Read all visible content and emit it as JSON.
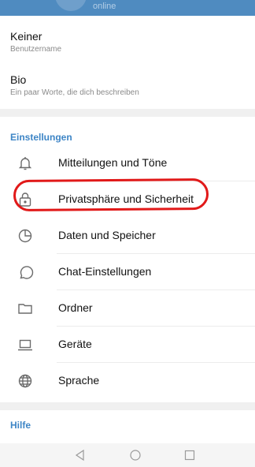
{
  "header": {
    "status": "online"
  },
  "profile": {
    "username_value": "Keiner",
    "username_caption": "Benutzername",
    "bio_value": "Bio",
    "bio_caption": "Ein paar Worte, die dich beschreiben"
  },
  "settings": {
    "section_title": "Einstellungen",
    "items": [
      {
        "label": "Mitteilungen und Töne",
        "icon": "bell-icon"
      },
      {
        "label": "Privatsphäre und Sicherheit",
        "icon": "lock-icon"
      },
      {
        "label": "Daten und Speicher",
        "icon": "pie-chart-icon"
      },
      {
        "label": "Chat-Einstellungen",
        "icon": "chat-bubble-icon"
      },
      {
        "label": "Ordner",
        "icon": "folder-icon"
      },
      {
        "label": "Geräte",
        "icon": "laptop-icon"
      },
      {
        "label": "Sprache",
        "icon": "globe-icon"
      }
    ]
  },
  "help": {
    "section_title": "Hilfe"
  },
  "annotation_color": "#e11919",
  "accent_color": "#3d85c6",
  "navbar": {
    "icons": [
      "back-icon",
      "home-icon",
      "recents-icon"
    ]
  }
}
